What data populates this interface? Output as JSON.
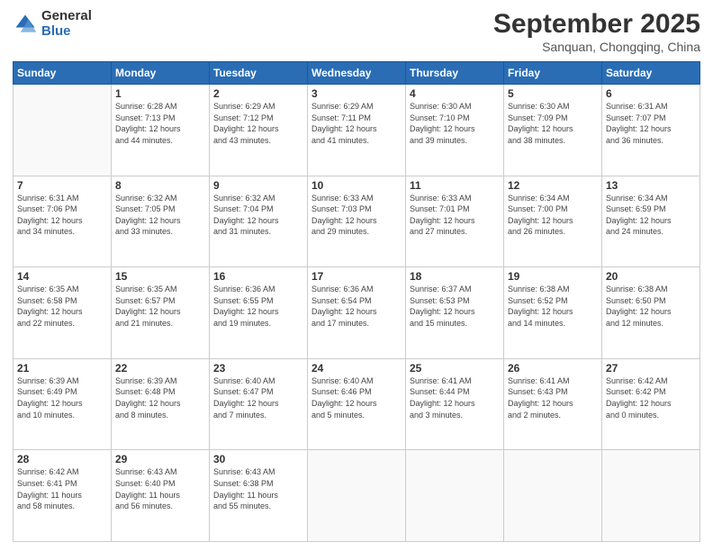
{
  "logo": {
    "general": "General",
    "blue": "Blue"
  },
  "header": {
    "month": "September 2025",
    "location": "Sanquan, Chongqing, China"
  },
  "days_of_week": [
    "Sunday",
    "Monday",
    "Tuesday",
    "Wednesday",
    "Thursday",
    "Friday",
    "Saturday"
  ],
  "weeks": [
    [
      {
        "day": "",
        "info": ""
      },
      {
        "day": "1",
        "info": "Sunrise: 6:28 AM\nSunset: 7:13 PM\nDaylight: 12 hours\nand 44 minutes."
      },
      {
        "day": "2",
        "info": "Sunrise: 6:29 AM\nSunset: 7:12 PM\nDaylight: 12 hours\nand 43 minutes."
      },
      {
        "day": "3",
        "info": "Sunrise: 6:29 AM\nSunset: 7:11 PM\nDaylight: 12 hours\nand 41 minutes."
      },
      {
        "day": "4",
        "info": "Sunrise: 6:30 AM\nSunset: 7:10 PM\nDaylight: 12 hours\nand 39 minutes."
      },
      {
        "day": "5",
        "info": "Sunrise: 6:30 AM\nSunset: 7:09 PM\nDaylight: 12 hours\nand 38 minutes."
      },
      {
        "day": "6",
        "info": "Sunrise: 6:31 AM\nSunset: 7:07 PM\nDaylight: 12 hours\nand 36 minutes."
      }
    ],
    [
      {
        "day": "7",
        "info": "Sunrise: 6:31 AM\nSunset: 7:06 PM\nDaylight: 12 hours\nand 34 minutes."
      },
      {
        "day": "8",
        "info": "Sunrise: 6:32 AM\nSunset: 7:05 PM\nDaylight: 12 hours\nand 33 minutes."
      },
      {
        "day": "9",
        "info": "Sunrise: 6:32 AM\nSunset: 7:04 PM\nDaylight: 12 hours\nand 31 minutes."
      },
      {
        "day": "10",
        "info": "Sunrise: 6:33 AM\nSunset: 7:03 PM\nDaylight: 12 hours\nand 29 minutes."
      },
      {
        "day": "11",
        "info": "Sunrise: 6:33 AM\nSunset: 7:01 PM\nDaylight: 12 hours\nand 27 minutes."
      },
      {
        "day": "12",
        "info": "Sunrise: 6:34 AM\nSunset: 7:00 PM\nDaylight: 12 hours\nand 26 minutes."
      },
      {
        "day": "13",
        "info": "Sunrise: 6:34 AM\nSunset: 6:59 PM\nDaylight: 12 hours\nand 24 minutes."
      }
    ],
    [
      {
        "day": "14",
        "info": "Sunrise: 6:35 AM\nSunset: 6:58 PM\nDaylight: 12 hours\nand 22 minutes."
      },
      {
        "day": "15",
        "info": "Sunrise: 6:35 AM\nSunset: 6:57 PM\nDaylight: 12 hours\nand 21 minutes."
      },
      {
        "day": "16",
        "info": "Sunrise: 6:36 AM\nSunset: 6:55 PM\nDaylight: 12 hours\nand 19 minutes."
      },
      {
        "day": "17",
        "info": "Sunrise: 6:36 AM\nSunset: 6:54 PM\nDaylight: 12 hours\nand 17 minutes."
      },
      {
        "day": "18",
        "info": "Sunrise: 6:37 AM\nSunset: 6:53 PM\nDaylight: 12 hours\nand 15 minutes."
      },
      {
        "day": "19",
        "info": "Sunrise: 6:38 AM\nSunset: 6:52 PM\nDaylight: 12 hours\nand 14 minutes."
      },
      {
        "day": "20",
        "info": "Sunrise: 6:38 AM\nSunset: 6:50 PM\nDaylight: 12 hours\nand 12 minutes."
      }
    ],
    [
      {
        "day": "21",
        "info": "Sunrise: 6:39 AM\nSunset: 6:49 PM\nDaylight: 12 hours\nand 10 minutes."
      },
      {
        "day": "22",
        "info": "Sunrise: 6:39 AM\nSunset: 6:48 PM\nDaylight: 12 hours\nand 8 minutes."
      },
      {
        "day": "23",
        "info": "Sunrise: 6:40 AM\nSunset: 6:47 PM\nDaylight: 12 hours\nand 7 minutes."
      },
      {
        "day": "24",
        "info": "Sunrise: 6:40 AM\nSunset: 6:46 PM\nDaylight: 12 hours\nand 5 minutes."
      },
      {
        "day": "25",
        "info": "Sunrise: 6:41 AM\nSunset: 6:44 PM\nDaylight: 12 hours\nand 3 minutes."
      },
      {
        "day": "26",
        "info": "Sunrise: 6:41 AM\nSunset: 6:43 PM\nDaylight: 12 hours\nand 2 minutes."
      },
      {
        "day": "27",
        "info": "Sunrise: 6:42 AM\nSunset: 6:42 PM\nDaylight: 12 hours\nand 0 minutes."
      }
    ],
    [
      {
        "day": "28",
        "info": "Sunrise: 6:42 AM\nSunset: 6:41 PM\nDaylight: 11 hours\nand 58 minutes."
      },
      {
        "day": "29",
        "info": "Sunrise: 6:43 AM\nSunset: 6:40 PM\nDaylight: 11 hours\nand 56 minutes."
      },
      {
        "day": "30",
        "info": "Sunrise: 6:43 AM\nSunset: 6:38 PM\nDaylight: 11 hours\nand 55 minutes."
      },
      {
        "day": "",
        "info": ""
      },
      {
        "day": "",
        "info": ""
      },
      {
        "day": "",
        "info": ""
      },
      {
        "day": "",
        "info": ""
      }
    ]
  ]
}
